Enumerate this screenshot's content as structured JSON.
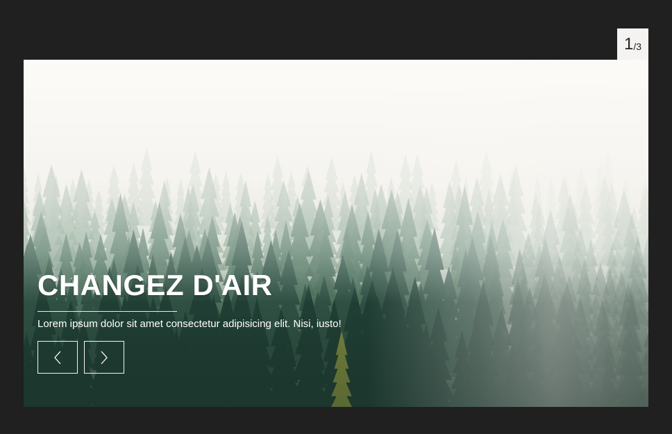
{
  "counter": {
    "current": "1",
    "separator": "/",
    "total": "3"
  },
  "slide": {
    "title": "CHANGEZ D'AIR",
    "description": "Lorem ipsum dolor sit amet consectetur adipisicing elit. Nisi, iusto!",
    "image_icon": "misty-forest-photo"
  },
  "nav": {
    "prev_icon": "chevron-left-icon",
    "next_icon": "chevron-right-icon"
  },
  "colors": {
    "page_background": "#202020",
    "counter_background": "#f4f3f1",
    "text": "#ffffff"
  }
}
